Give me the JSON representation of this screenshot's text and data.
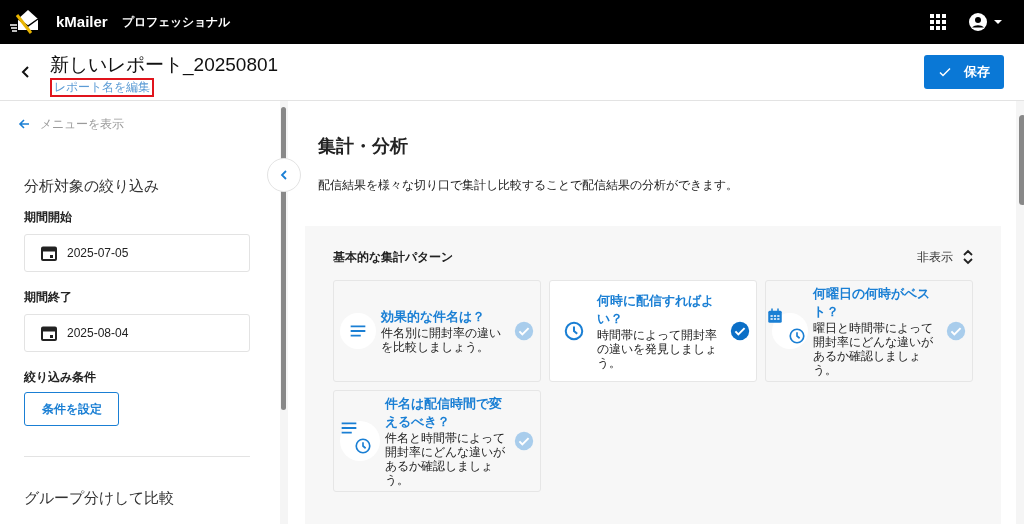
{
  "app_bar": {
    "brand": "kMailer",
    "edition": "プロフェッショナル"
  },
  "report": {
    "title": "新しいレポート_20250801",
    "rename_link": "レポート名を編集",
    "rename_highlighted": true,
    "save_button": "保存"
  },
  "sidebar": {
    "show_menu": "メニューを表示",
    "filter_heading": "分析対象の絞り込み",
    "period_start_label": "期間開始",
    "period_start": "2025-07-05",
    "period_end_label": "期間終了",
    "period_end": "2025-08-04",
    "conditions_label": "絞り込み条件",
    "conditions_button": "条件を設定",
    "group_heading": "グループ分けして比較"
  },
  "main": {
    "heading": "集計・分析",
    "description": "配信結果を様々な切り口で集計し比較することで配信結果の分析ができます。",
    "patterns": {
      "title": "基本的な集計パターン",
      "toggle": "非表示",
      "cards": [
        {
          "kind": "lines",
          "title": "効果的な件名は？",
          "description": "件名別に開封率の違いを比較しましょう。",
          "selected": false
        },
        {
          "kind": "clock",
          "title": "何時に配信すればよい？",
          "description": "時間帯によって開封率の違いを発見しましょう。",
          "selected": true
        },
        {
          "kind": "calendar-clock",
          "title": "何曜日の何時がベスト？",
          "description": "曜日と時間帯によって開封率にどんな違いがあるか確認しましょう。",
          "selected": false
        },
        {
          "kind": "lines-clock",
          "title": "件名は配信時間で変えるべき？",
          "description": "件名と時間帯によって開封率にどんな違いがあるか確認しましょう。",
          "selected": false
        }
      ]
    }
  }
}
